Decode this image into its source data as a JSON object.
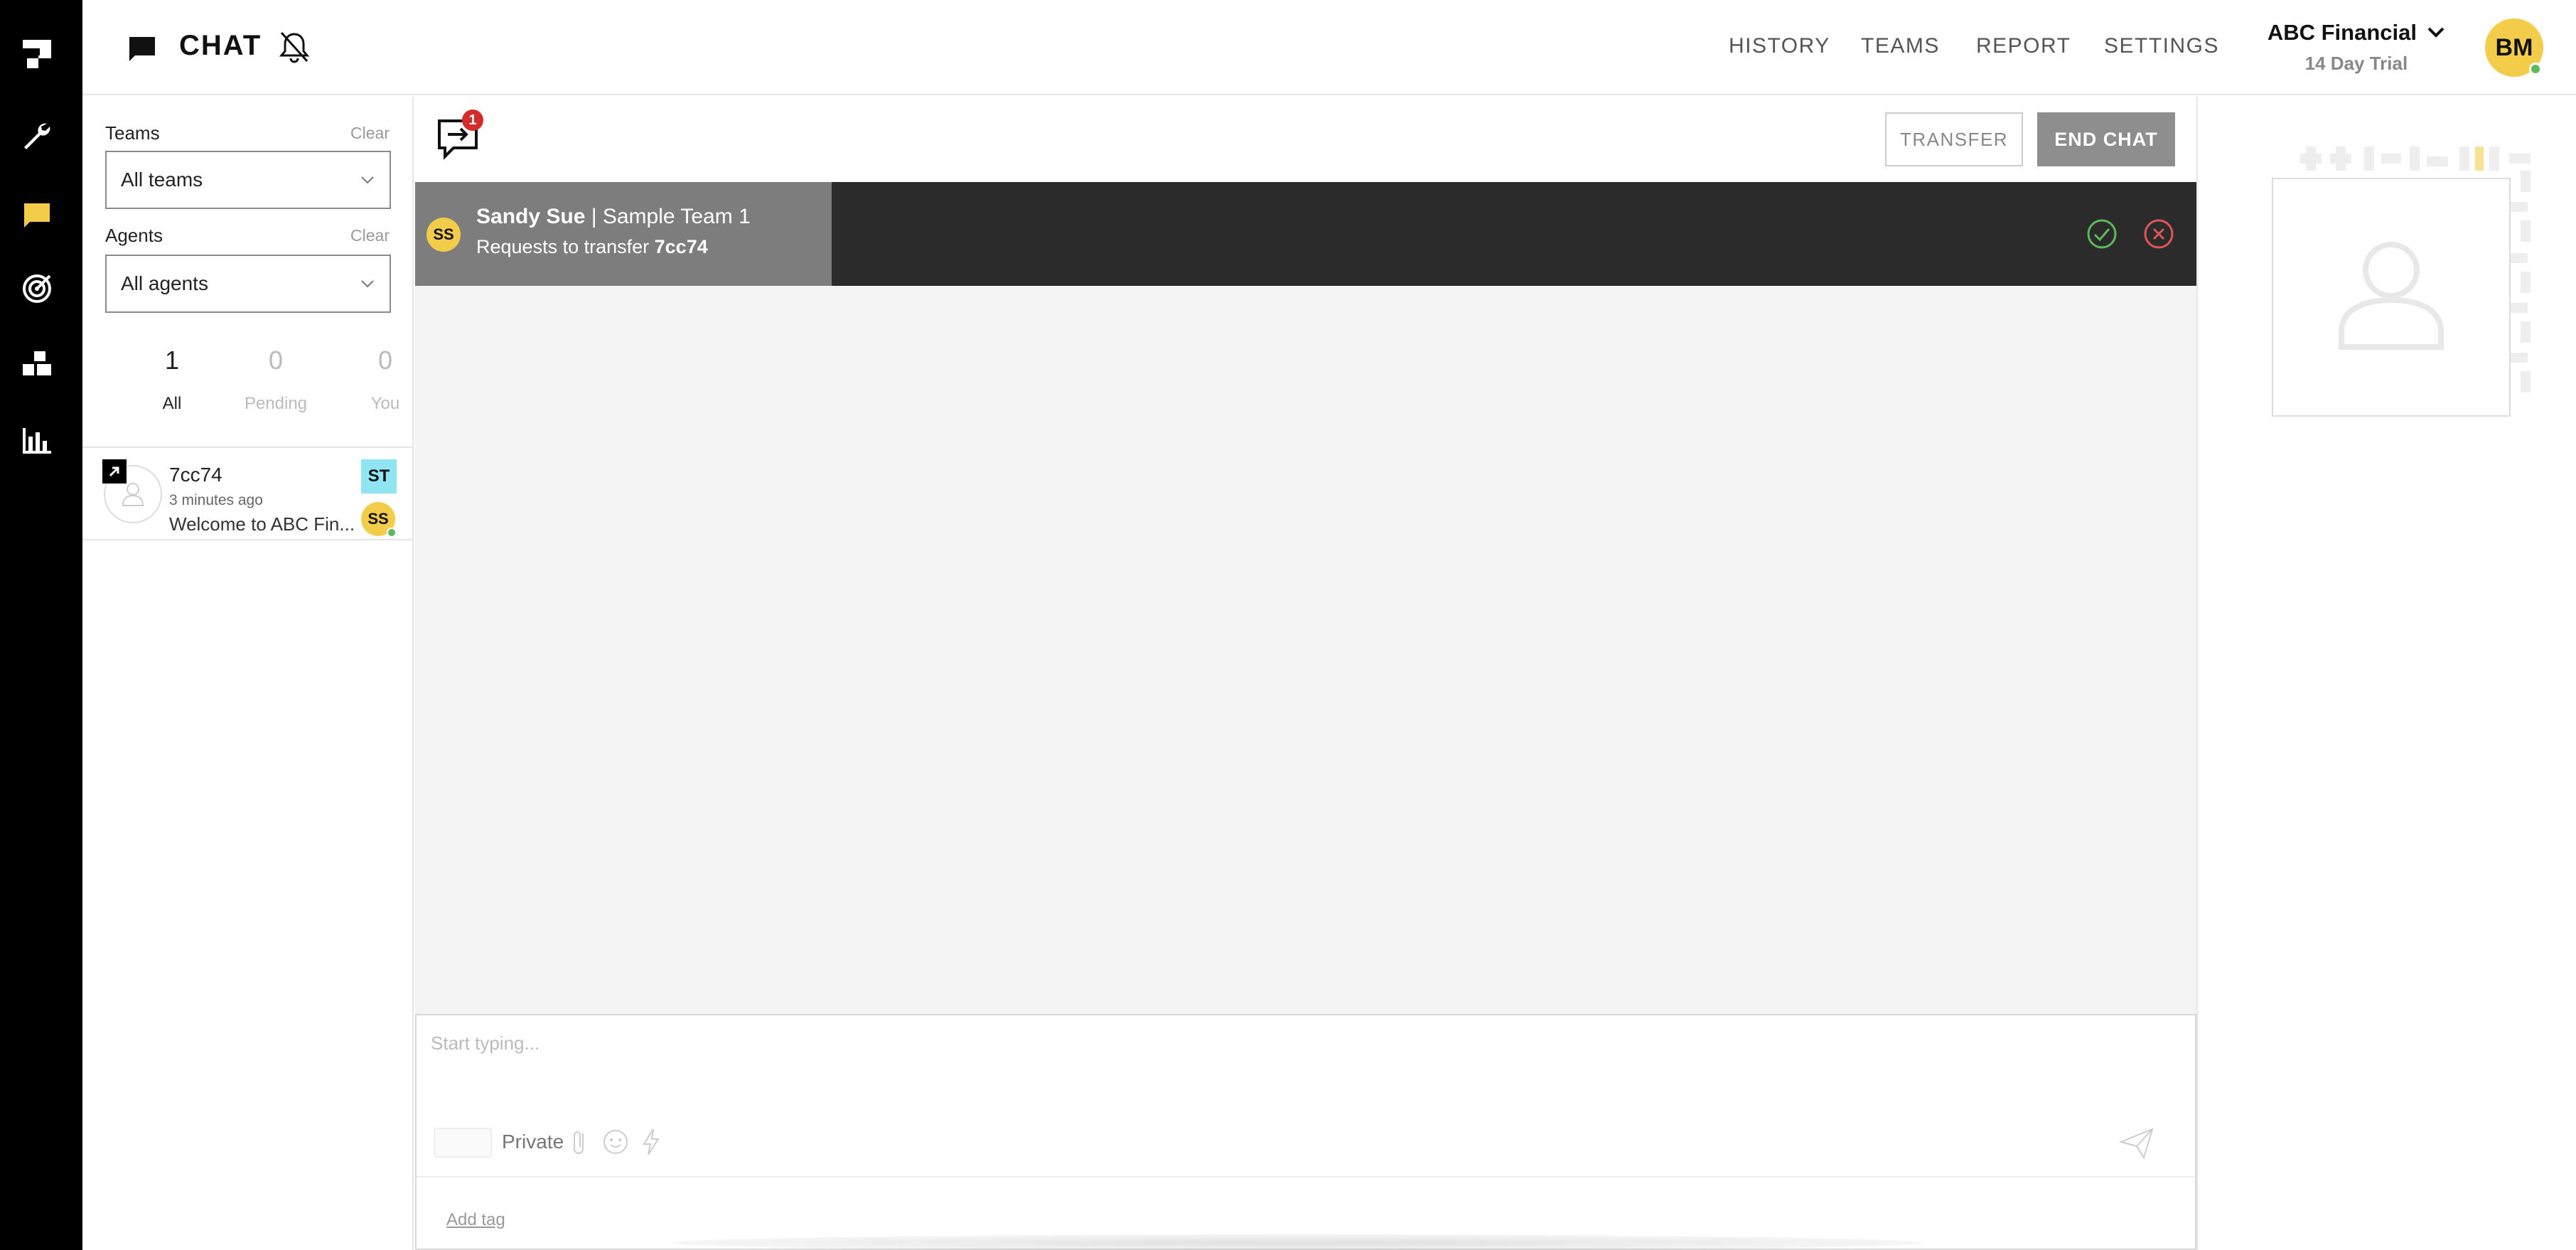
{
  "header": {
    "title": "CHAT",
    "nav": [
      "HISTORY",
      "TEAMS",
      "REPORT",
      "SETTINGS"
    ],
    "org_name": "ABC Financial",
    "org_subtitle": "14 Day Trial",
    "user_initials": "BM"
  },
  "rail": {
    "icons": [
      "logo-icon",
      "wrench-icon",
      "chat-icon",
      "target-icon",
      "teams-icon",
      "bar-chart-icon"
    ]
  },
  "filters": {
    "teams_label": "Teams",
    "teams_clear": "Clear",
    "teams_value": "All teams",
    "agents_label": "Agents",
    "agents_clear": "Clear",
    "agents_value": "All agents",
    "counts": [
      {
        "value": "1",
        "label": "All"
      },
      {
        "value": "0",
        "label": "Pending"
      },
      {
        "value": "0",
        "label": "You"
      }
    ]
  },
  "conversation": {
    "id": "7cc74",
    "time": "3 minutes ago",
    "preview": "Welcome to ABC Fin...",
    "team_tag": "ST",
    "agent_initials": "SS"
  },
  "chat": {
    "notification_count": "1",
    "transfer_label": "TRANSFER",
    "end_label": "END CHAT"
  },
  "transfer_request": {
    "initials": "SS",
    "agent": "Sandy Sue",
    "team": "Sample Team 1",
    "text": "Requests to transfer",
    "conversation_id": "7cc74"
  },
  "composer": {
    "placeholder": "Start typing...",
    "private_label": "Private",
    "add_tag": "Add tag"
  },
  "colors": {
    "accent_yellow": "#f3cd4a",
    "team_tag": "#8fe6f2",
    "online": "#5fb85b",
    "accept": "#5fb85b",
    "reject": "#e05555",
    "notification": "#d42b2b"
  }
}
